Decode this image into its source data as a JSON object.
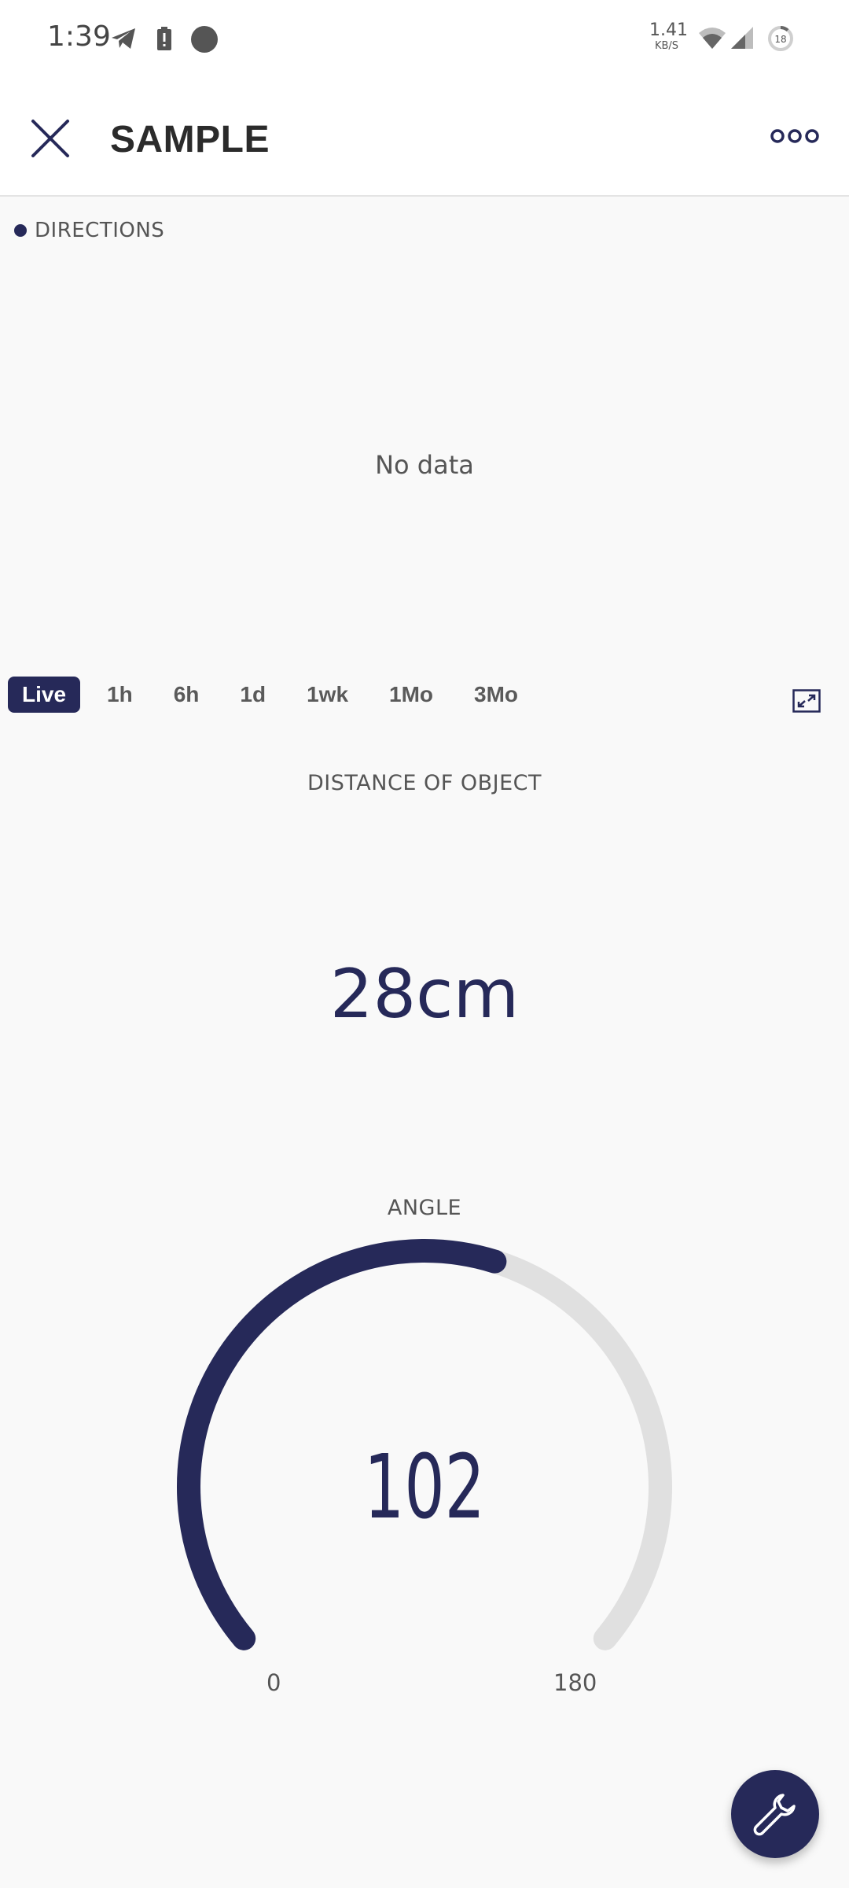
{
  "status_bar": {
    "time": "1:39",
    "net_speed_value": "1.41",
    "net_speed_unit": "KB/S",
    "battery_level": "18",
    "icons": [
      "telegram-icon",
      "battery-alert-icon",
      "circle-notification-icon",
      "wifi-icon",
      "signal-icon",
      "battery-icon"
    ]
  },
  "app_bar": {
    "title": "SAMPLE",
    "close_icon": "close-icon",
    "more_icon": "more-options-icon"
  },
  "directions_chart": {
    "legend_label": "DIRECTIONS",
    "empty_message": "No data",
    "legend_color": "#262959"
  },
  "time_range": {
    "options": [
      "Live",
      "1h",
      "6h",
      "1d",
      "1wk",
      "1Mo",
      "3Mo"
    ],
    "selected": "Live",
    "expand_icon": "expand-icon"
  },
  "distance": {
    "label": "DISTANCE OF OBJECT",
    "value": "28cm"
  },
  "angle": {
    "label": "ANGLE",
    "value": "102",
    "numeric_value": 102,
    "min": "0",
    "max": "180",
    "min_value": 0,
    "max_value": 180,
    "fill_color": "#262959",
    "track_color": "#e0e0e0"
  },
  "fab": {
    "icon": "wrench-icon"
  },
  "colors": {
    "accent": "#262959",
    "background": "#f9f9f9"
  }
}
